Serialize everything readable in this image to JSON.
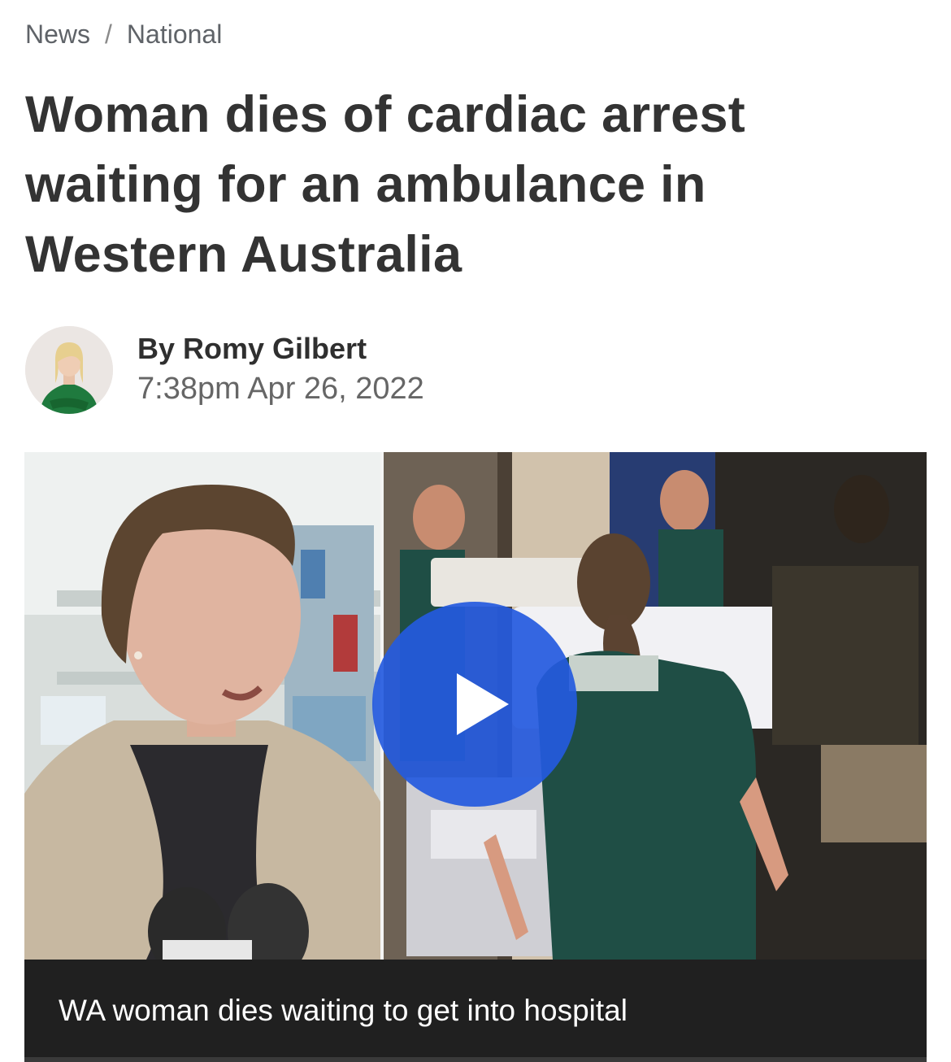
{
  "breadcrumb": {
    "items": [
      "News",
      "National"
    ],
    "separator": "/"
  },
  "article": {
    "headline": "Woman dies of cardiac arrest waiting for an ambulance in Western Australia",
    "author": "By Romy Gilbert",
    "timestamp": "7:38pm Apr 26, 2022"
  },
  "video": {
    "caption": "WA woman dies waiting to get into hospital",
    "play_icon": "play-icon",
    "play_color": "#245ade"
  },
  "colors": {
    "headline": "#333333",
    "breadcrumb": "#5f6368",
    "caption_bar": "#202020",
    "paramedic_uniform": "#1f4e45"
  }
}
